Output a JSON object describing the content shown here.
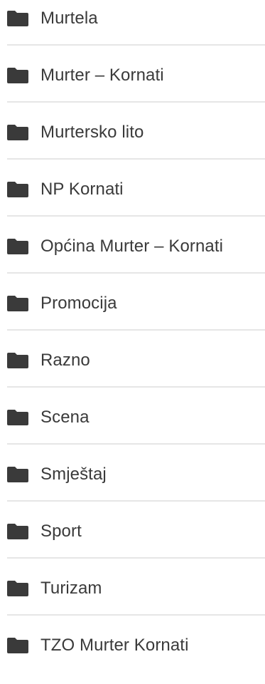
{
  "categories": [
    {
      "label": "Murtela"
    },
    {
      "label": "Murter – Kornati"
    },
    {
      "label": "Murtersko lito"
    },
    {
      "label": "NP Kornati"
    },
    {
      "label": "Općina Murter – Kornati"
    },
    {
      "label": "Promocija"
    },
    {
      "label": "Razno"
    },
    {
      "label": "Scena"
    },
    {
      "label": "Smještaj"
    },
    {
      "label": "Sport"
    },
    {
      "label": "Turizam"
    },
    {
      "label": "TZO Murter Kornati"
    }
  ],
  "icon": "folder-icon",
  "colors": {
    "text": "#3a3a3a",
    "icon": "#3a3a3a",
    "divider": "#e6e6e6"
  }
}
